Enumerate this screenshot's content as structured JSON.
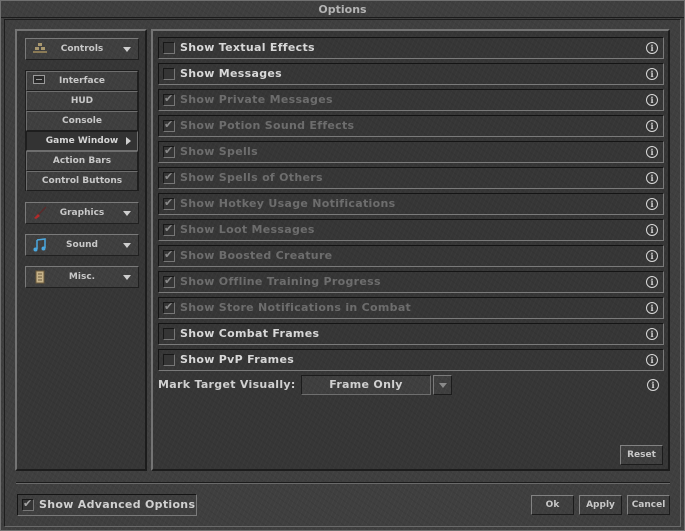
{
  "window": {
    "title": "Options"
  },
  "nav": {
    "groups": [
      {
        "label": "Controls",
        "icon": "controls-icon",
        "expanded": true
      },
      {
        "label": "Graphics",
        "icon": "brush-icon",
        "expanded": false
      },
      {
        "label": "Sound",
        "icon": "music-note-icon",
        "expanded": false
      },
      {
        "label": "Misc.",
        "icon": "scroll-icon",
        "expanded": false
      }
    ],
    "sub_items": [
      {
        "label": "Interface",
        "icon": "interface-icon",
        "active": false
      },
      {
        "label": "HUD",
        "active": false
      },
      {
        "label": "Console",
        "active": false
      },
      {
        "label": "Game Window",
        "active": true
      },
      {
        "label": "Action Bars",
        "active": false
      },
      {
        "label": "Control Buttons",
        "active": false
      }
    ]
  },
  "options": [
    {
      "label": "Show Textual Effects",
      "checked": false,
      "enabled": true
    },
    {
      "label": "Show Messages",
      "checked": false,
      "enabled": true
    },
    {
      "label": "Show Private Messages",
      "checked": true,
      "enabled": false
    },
    {
      "label": "Show Potion Sound Effects",
      "checked": true,
      "enabled": false
    },
    {
      "label": "Show Spells",
      "checked": true,
      "enabled": false
    },
    {
      "label": "Show Spells of Others",
      "checked": true,
      "enabled": false
    },
    {
      "label": "Show Hotkey Usage Notifications",
      "checked": true,
      "enabled": false
    },
    {
      "label": "Show Loot Messages",
      "checked": true,
      "enabled": false
    },
    {
      "label": "Show Boosted Creature",
      "checked": true,
      "enabled": false
    },
    {
      "label": "Show Offline Training Progress",
      "checked": true,
      "enabled": false
    },
    {
      "label": "Show Store Notifications in Combat",
      "checked": true,
      "enabled": false
    },
    {
      "label": "Show Combat Frames",
      "checked": false,
      "enabled": true
    },
    {
      "label": "Show PvP Frames",
      "checked": false,
      "enabled": true
    }
  ],
  "mark_target": {
    "label": "Mark Target Visually:",
    "value": "Frame Only"
  },
  "buttons": {
    "reset": "Reset",
    "ok": "Ok",
    "apply": "Apply",
    "cancel": "Cancel"
  },
  "advanced": {
    "label": "Show Advanced Options",
    "checked": true
  },
  "glyphs": {
    "check": "✔",
    "info": "i"
  }
}
